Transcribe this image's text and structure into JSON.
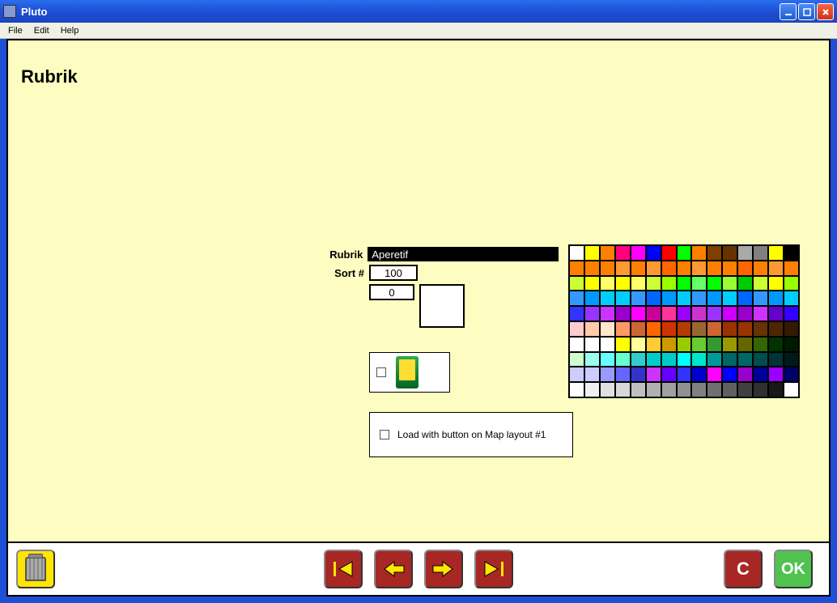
{
  "window": {
    "title": "Pluto"
  },
  "menu": {
    "file": "File",
    "edit": "Edit",
    "help": "Help"
  },
  "page": {
    "heading": "Rubrik",
    "labels": {
      "rubrik": "Rubrik",
      "sort": "Sort #"
    },
    "fields": {
      "rubrik_value": "Aperetif",
      "sort_value": "100",
      "aux_value": "0"
    },
    "load_label": "Load with button on Map layout #1",
    "buttons": {
      "cancel": "C",
      "ok": "OK"
    }
  },
  "palette_rows": [
    [
      "#ffffff",
      "#ffff00",
      "#ff7f00",
      "#ff007f",
      "#ff00ff",
      "#0000ff",
      "#ff0000",
      "#00ff00",
      "#ff7f00",
      "#7f3f00",
      "#663300",
      "#a9a9a9",
      "#808080",
      "#ffff00",
      "#000000"
    ],
    [
      "#ff7f00",
      "#ff7f00",
      "#ff7f00",
      "#ff9933",
      "#ff7f00",
      "#ff9933",
      "#ff6600",
      "#ff7f00",
      "#ff9933",
      "#ff7f00",
      "#ff7f00",
      "#ff6600",
      "#ff7f00",
      "#ff9933",
      "#ff7f00"
    ],
    [
      "#ccff33",
      "#ffff00",
      "#ffff66",
      "#ffff00",
      "#ffff66",
      "#ccff33",
      "#99ff00",
      "#00ff00",
      "#66ff66",
      "#00ff00",
      "#99ff33",
      "#00cc00",
      "#ccff33",
      "#ffff00",
      "#99ff00"
    ],
    [
      "#3399ff",
      "#0099ff",
      "#00ccff",
      "#00ccff",
      "#3399ff",
      "#0066ff",
      "#0099ff",
      "#00ccff",
      "#3399ff",
      "#0099ff",
      "#00ccff",
      "#0066ff",
      "#3399ff",
      "#0099ff",
      "#00ccff"
    ],
    [
      "#3333ff",
      "#9933ff",
      "#cc33ff",
      "#9900cc",
      "#ff00ff",
      "#cc0099",
      "#ff3399",
      "#9900ff",
      "#cc33cc",
      "#9933ff",
      "#cc00ff",
      "#9900cc",
      "#cc33ff",
      "#6600cc",
      "#3300ff"
    ],
    [
      "#ffcccc",
      "#ffccaa",
      "#ffe6cc",
      "#ff9966",
      "#cc6633",
      "#ff6600",
      "#cc3300",
      "#b33c00",
      "#996633",
      "#cc6633",
      "#993300",
      "#993300",
      "#663300",
      "#4d2600",
      "#331a00"
    ],
    [
      "#ffffff",
      "#ffffff",
      "#ffffff",
      "#ffff00",
      "#ffff99",
      "#ffcc33",
      "#cc9900",
      "#99cc00",
      "#66cc33",
      "#339933",
      "#999900",
      "#666600",
      "#336600",
      "#003300",
      "#001a00"
    ],
    [
      "#ccffcc",
      "#99ffee",
      "#66ffff",
      "#66ffcc",
      "#33cccc",
      "#00cccc",
      "#00cccc",
      "#00ffff",
      "#00e6cc",
      "#009999",
      "#006666",
      "#006666",
      "#004d4d",
      "#003333",
      "#001a1a"
    ],
    [
      "#ccccff",
      "#ccccff",
      "#9999ff",
      "#6666ff",
      "#3333cc",
      "#cc33ff",
      "#6600ff",
      "#3333ff",
      "#0000cc",
      "#ff00ff",
      "#0000ff",
      "#9900cc",
      "#000099",
      "#9900ff",
      "#000066"
    ],
    [
      "#ffffff",
      "#f0f0f0",
      "#e0e0e0",
      "#d8d8d8",
      "#c0c0c0",
      "#b0b0b0",
      "#a0a0a0",
      "#909090",
      "#808080",
      "#707070",
      "#606060",
      "#404040",
      "#303030",
      "#181818",
      "#ffffff"
    ]
  ]
}
